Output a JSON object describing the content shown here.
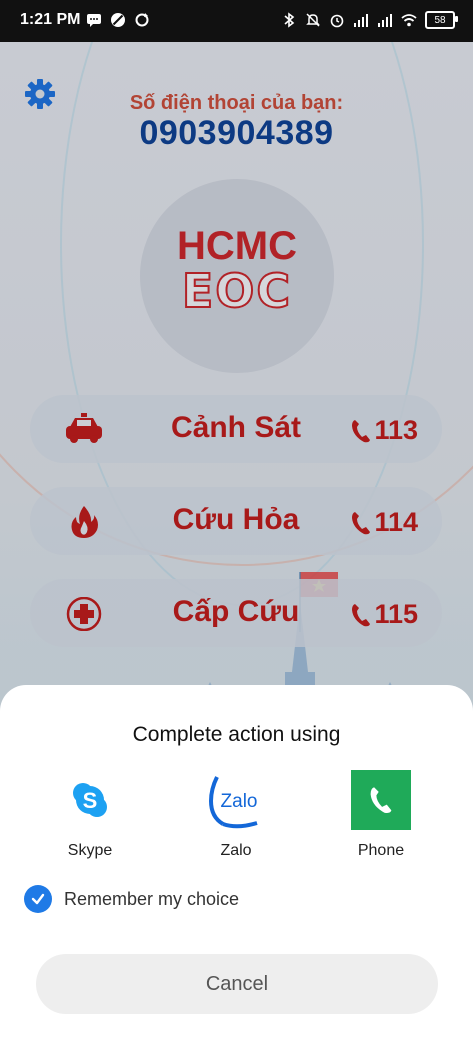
{
  "status_bar": {
    "time": "1:21 PM",
    "battery": "58",
    "left_icons": [
      "message-icon",
      "block-icon",
      "sync-icon"
    ],
    "right_icons": [
      "bluetooth-icon",
      "mute-icon",
      "alarm-icon",
      "signal-icon",
      "signal-icon",
      "wifi-icon"
    ]
  },
  "app": {
    "phone_label": "Số điện thoại của bạn:",
    "phone_number": "0903904389",
    "logo_top": "HCMC",
    "logo_bottom": "EOC",
    "buttons": [
      {
        "label": "Cảnh Sát",
        "number": "113",
        "icon": "police-car-icon"
      },
      {
        "label": "Cứu Hỏa",
        "number": "114",
        "icon": "fire-icon"
      },
      {
        "label": "Cấp Cứu",
        "number": "115",
        "icon": "medical-cross-icon"
      }
    ],
    "colors": {
      "accent_red": "#b71c1c",
      "number_blue": "#0f3f8f",
      "gear_blue": "#1f6fd6"
    }
  },
  "sheet": {
    "title": "Complete action using",
    "apps": [
      {
        "name": "Skype",
        "icon": "skype-icon"
      },
      {
        "name": "Zalo",
        "icon": "zalo-icon",
        "icon_text": "Zalo"
      },
      {
        "name": "Phone",
        "icon": "phone-icon"
      }
    ],
    "remember_label": "Remember my choice",
    "remember_checked": true,
    "cancel_label": "Cancel"
  }
}
